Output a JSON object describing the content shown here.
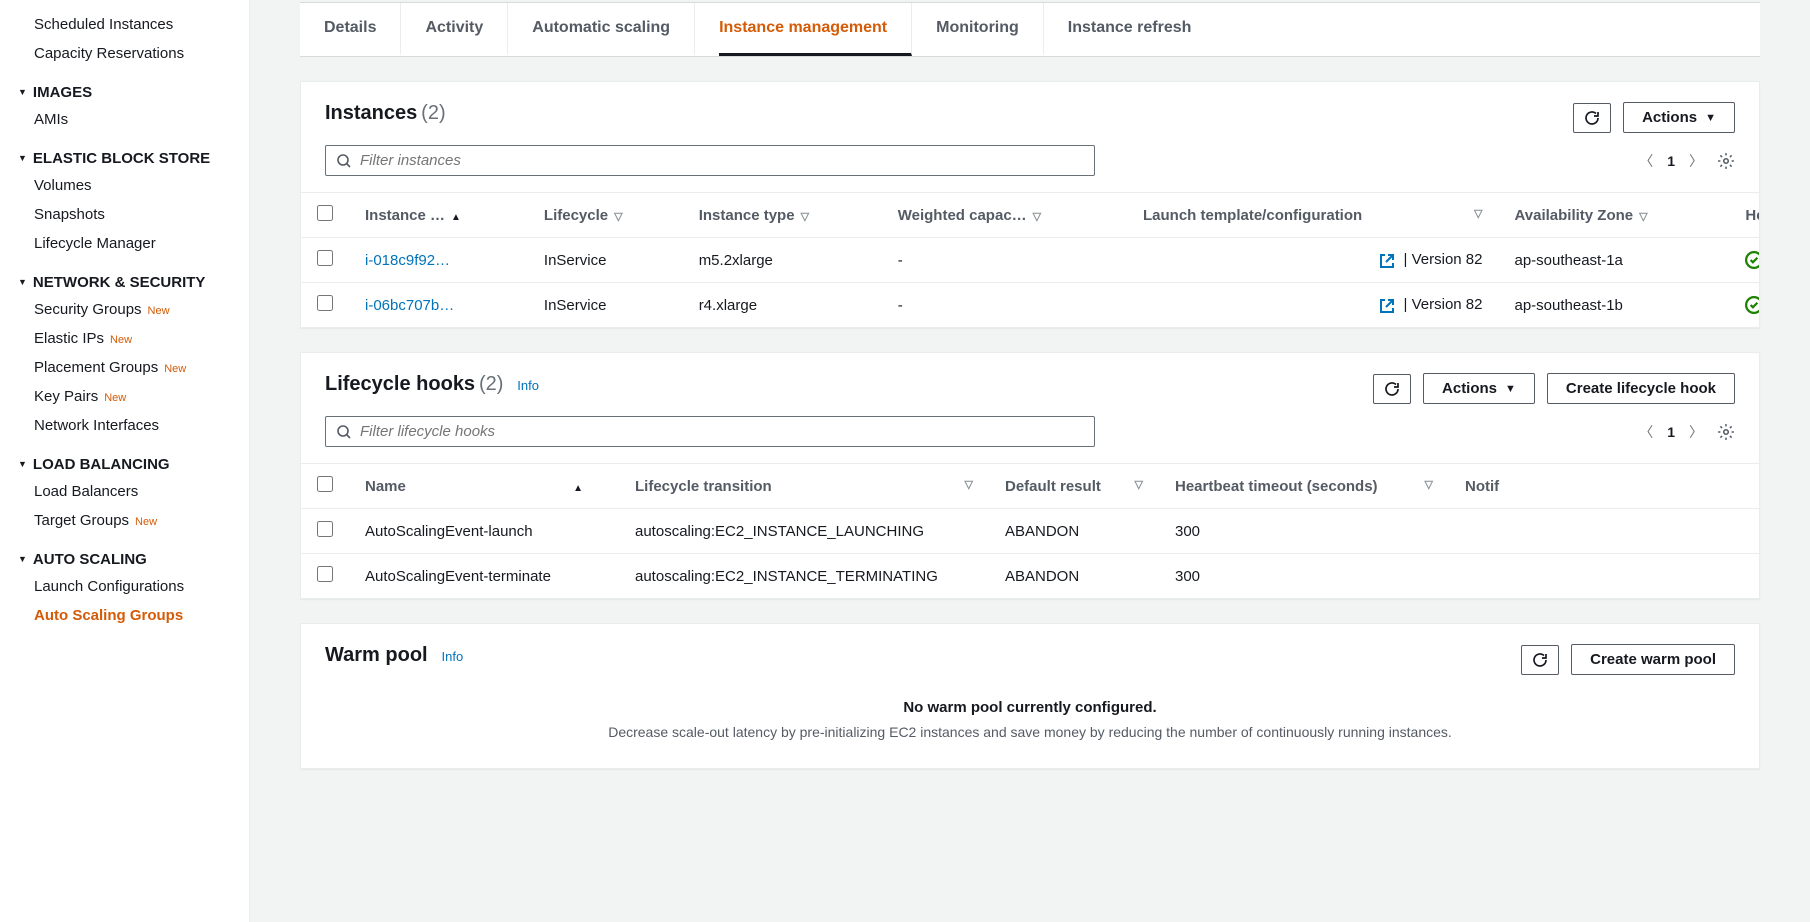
{
  "sidebar": {
    "items": [
      {
        "label": "Scheduled Instances",
        "group": false
      },
      {
        "label": "Capacity Reservations",
        "group": false
      },
      {
        "label": "IMAGES",
        "group": true
      },
      {
        "label": "AMIs",
        "group": false
      },
      {
        "label": "ELASTIC BLOCK STORE",
        "group": true
      },
      {
        "label": "Volumes",
        "group": false
      },
      {
        "label": "Snapshots",
        "group": false
      },
      {
        "label": "Lifecycle Manager",
        "group": false
      },
      {
        "label": "NETWORK & SECURITY",
        "group": true
      },
      {
        "label": "Security Groups",
        "group": false,
        "new": "New"
      },
      {
        "label": "Elastic IPs",
        "group": false,
        "new": "New"
      },
      {
        "label": "Placement Groups",
        "group": false,
        "new": "New"
      },
      {
        "label": "Key Pairs",
        "group": false,
        "new": "New"
      },
      {
        "label": "Network Interfaces",
        "group": false
      },
      {
        "label": "LOAD BALANCING",
        "group": true
      },
      {
        "label": "Load Balancers",
        "group": false
      },
      {
        "label": "Target Groups",
        "group": false,
        "new": "New"
      },
      {
        "label": "AUTO SCALING",
        "group": true
      },
      {
        "label": "Launch Configurations",
        "group": false
      },
      {
        "label": "Auto Scaling Groups",
        "group": false,
        "active": true
      }
    ]
  },
  "tabs": [
    {
      "label": "Details"
    },
    {
      "label": "Activity"
    },
    {
      "label": "Automatic scaling"
    },
    {
      "label": "Instance management",
      "active": true
    },
    {
      "label": "Monitoring"
    },
    {
      "label": "Instance refresh"
    }
  ],
  "instancesPanel": {
    "title": "Instances",
    "count": "(2)",
    "actions": "Actions",
    "filterPlaceholder": "Filter instances",
    "page": "1",
    "columns": {
      "instance": "Instance …",
      "lifecycle": "Lifecycle",
      "type": "Instance type",
      "weighted": "Weighted capac…",
      "launch": "Launch template/configuration",
      "az": "Availability Zone",
      "health": "He"
    },
    "rows": [
      {
        "id": "i-018c9f92…",
        "lifecycle": "InService",
        "type": "m5.2xlarge",
        "weighted": "-",
        "launch": "| Version 82",
        "az": "ap-southeast-1a"
      },
      {
        "id": "i-06bc707b…",
        "lifecycle": "InService",
        "type": "r4.xlarge",
        "weighted": "-",
        "launch": "| Version 82",
        "az": "ap-southeast-1b"
      }
    ]
  },
  "hooksPanel": {
    "title": "Lifecycle hooks",
    "count": "(2)",
    "info": "Info",
    "actions": "Actions",
    "create": "Create lifecycle hook",
    "filterPlaceholder": "Filter lifecycle hooks",
    "page": "1",
    "columns": {
      "name": "Name",
      "transition": "Lifecycle transition",
      "result": "Default result",
      "heartbeat": "Heartbeat timeout (seconds)",
      "notif": "Notif"
    },
    "rows": [
      {
        "name": "AutoScalingEvent-launch",
        "transition": "autoscaling:EC2_INSTANCE_LAUNCHING",
        "result": "ABANDON",
        "heartbeat": "300"
      },
      {
        "name": "AutoScalingEvent-terminate",
        "transition": "autoscaling:EC2_INSTANCE_TERMINATING",
        "result": "ABANDON",
        "heartbeat": "300"
      }
    ]
  },
  "warmPanel": {
    "title": "Warm pool",
    "info": "Info",
    "create": "Create warm pool",
    "emptyTitle": "No warm pool currently configured.",
    "emptyDesc": "Decrease scale-out latency by pre-initializing EC2 instances and save money by reducing the number of continuously running instances."
  }
}
